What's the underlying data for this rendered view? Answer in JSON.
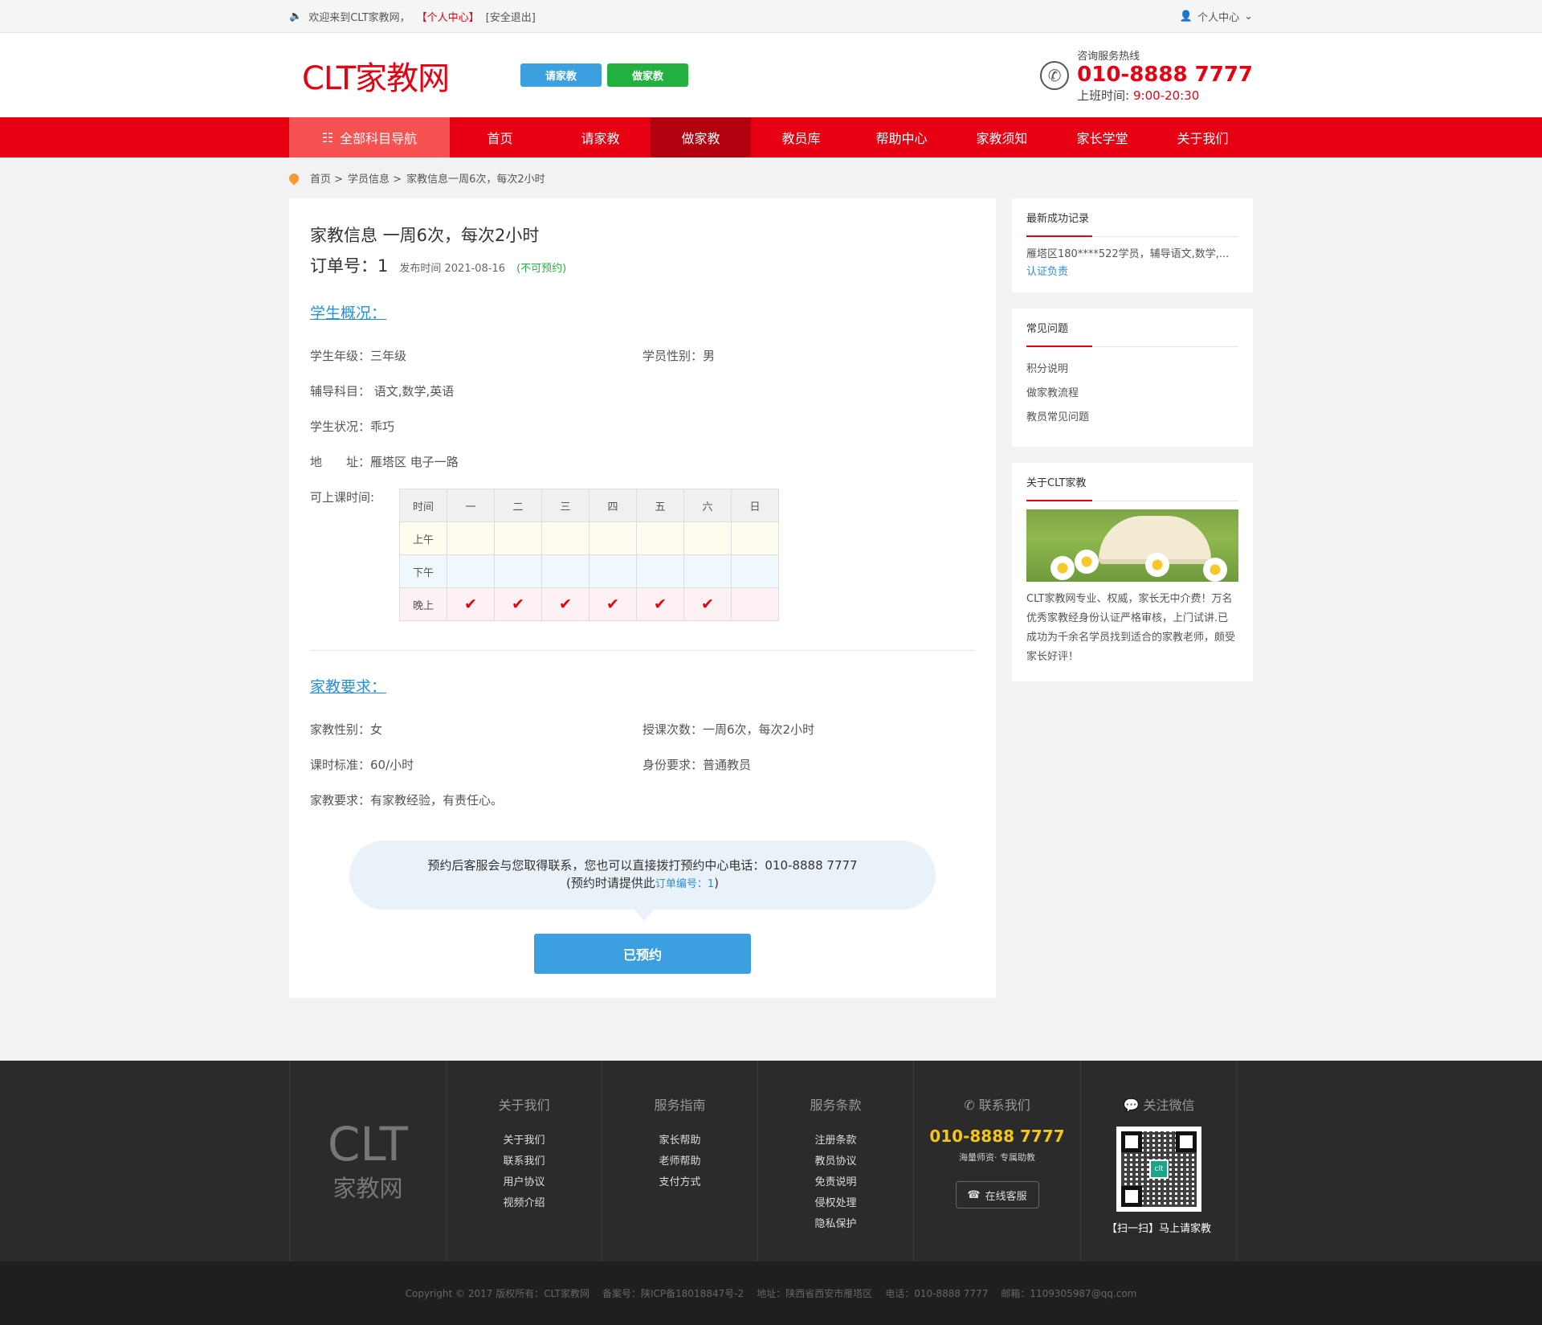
{
  "topbar": {
    "welcome": "欢迎来到CLT家教网，",
    "personal_center_link": "【个人中心】",
    "logout_link": "[安全退出]",
    "user_menu": "个人中心"
  },
  "header": {
    "logo": "CLT家教网",
    "btn_hire": "请家教",
    "btn_teach": "做家教",
    "hotline_label": "咨询服务热线",
    "hotline_number": "010-8888 7777",
    "hours_label": "上班时间:",
    "hours_value": "9:00-20:30"
  },
  "nav": {
    "all": "全部科目导航",
    "items": [
      "首页",
      "请家教",
      "做家教",
      "教员库",
      "帮助中心",
      "家教须知",
      "家长学堂",
      "关于我们"
    ]
  },
  "breadcrumb": [
    "首页 >",
    "学员信息 >",
    "家教信息一周6次，每次2小时"
  ],
  "detail": {
    "title": "家教信息 一周6次，每次2小时",
    "order_label": "订单号：1",
    "publish": "发布时间 2021-08-16",
    "status": "(不可预约)",
    "section_student": "学生概况：",
    "grade": "学生年级：三年级",
    "gender": "学员性别：男",
    "subjects": "辅导科目： 语文,数学,英语",
    "condition": "学生状况：乖巧",
    "address": "地　　址：雁塔区 电子一路",
    "schedule_label": "可上课时间:",
    "schedule_head": [
      "时间",
      "一",
      "二",
      "三",
      "四",
      "五",
      "六",
      "日"
    ],
    "schedule_rows": [
      {
        "label": "上午",
        "checks": [
          false,
          false,
          false,
          false,
          false,
          false,
          false
        ]
      },
      {
        "label": "下午",
        "checks": [
          false,
          false,
          false,
          false,
          false,
          false,
          false
        ]
      },
      {
        "label": "晚上",
        "checks": [
          true,
          true,
          true,
          true,
          true,
          true,
          false
        ]
      }
    ],
    "section_req": "家教要求：",
    "tutor_gender": "家教性别：女",
    "frequency": "授课次数：一周6次，每次2小时",
    "fee": "课时标准：60/小时",
    "identity": "身份要求：普通教员",
    "requirement": "家教要求：有家教经验，有责任心。",
    "bubble_line1": "预约后客服会与您取得联系，您也可以直接拨打预约中心电话：010-8888 7777",
    "bubble_line2_pre": "(预约时请提供此",
    "bubble_line2_code": "订单编号：1",
    "bubble_line2_post": ")",
    "reserved_button": "已预约"
  },
  "sidebar": {
    "success_title": "最新成功记录",
    "success_text": "雁塔区180****522学员，辅导语文,数学,...",
    "success_link": "认证负责",
    "faq_title": "常见问题",
    "faq_items": [
      "积分说明",
      "做家教流程",
      "教员常见问题"
    ],
    "about_title": "关于CLT家教",
    "about_text": "CLT家教网专业、权威，家长无中介费！万名优秀家教经身份认证严格审核，上门试讲.已成功为千余名学员找到适合的家教老师，颇受家长好评！"
  },
  "footer": {
    "logo_a": "CLT",
    "logo_b": "家教网",
    "col1_title": "关于我们",
    "col1": [
      "关于我们",
      "联系我们",
      "用户协议",
      "视频介绍"
    ],
    "col2_title": "服务指南",
    "col2": [
      "家长帮助",
      "老师帮助",
      "支付方式"
    ],
    "col3_title": "服务条款",
    "col3": [
      "注册条款",
      "教员协议",
      "免责说明",
      "侵权处理",
      "隐私保护"
    ],
    "contact_title": "联系我们",
    "contact_phone": "010-8888 7777",
    "contact_sub": "海量师资· 专属助教",
    "online_service": "在线客服",
    "wechat_title": "关注微信",
    "wechat_caption": "【扫一扫】马上请家教",
    "qr_logo": "clt"
  },
  "copyright": [
    "Copyright © 2017 版权所有：CLT家教网",
    "备案号：陕ICP备18018847号-2",
    "地址：陕西省西安市雁塔区",
    "电话：010-8888 7777",
    "邮箱：1109305987@qq.com"
  ]
}
